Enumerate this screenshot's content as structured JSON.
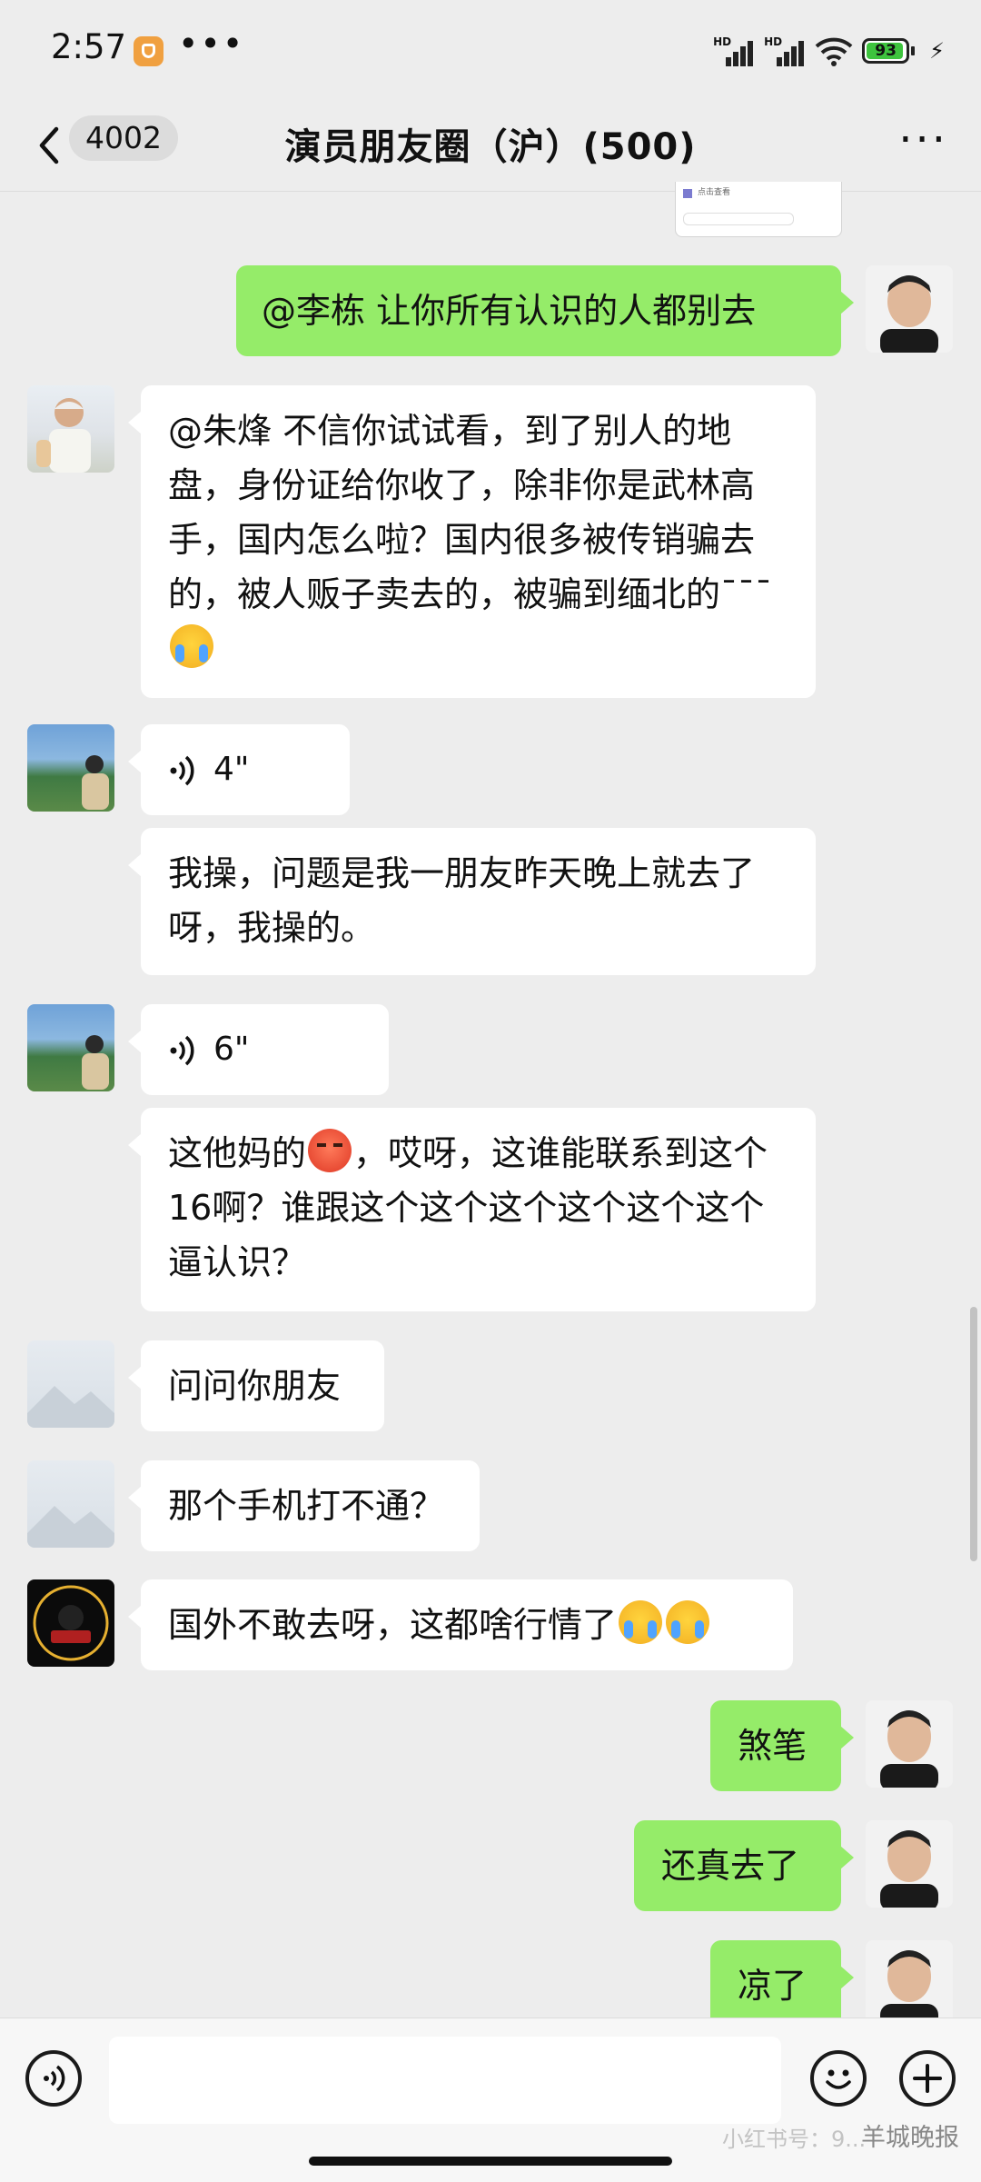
{
  "status_bar": {
    "time": "2:57",
    "battery": "93",
    "network_labels": [
      "HD",
      "HD"
    ]
  },
  "header": {
    "unread_count": "4002",
    "title": "演员朋友圈（沪）(500)"
  },
  "messages": [
    {
      "side": "right",
      "text": "@李栋  让你所有认识的人都别去"
    },
    {
      "side": "left",
      "text_parts": [
        "@朱烽 不信你试试看，到了别人的地盘，身份证给你收了，除非你是武林高手，国内怎么啦？国内很多被传销骗去的，被人贩子卖去的，被骗到缅北的¯¯¯"
      ],
      "emoji": "crying-emoji"
    },
    {
      "side": "left",
      "voice": "4\""
    },
    {
      "side": "left",
      "text": "我操，问题是我一朋友昨天晚上就去了呀，我操的。"
    },
    {
      "side": "left",
      "voice": "6\""
    },
    {
      "side": "left",
      "text_a": "这他妈的",
      "text_b": "，哎呀，这谁能联系到这个16啊？谁跟这个这个这个这个这个这个逼认识？",
      "emoji": "angry-emoji"
    },
    {
      "side": "left",
      "text": "问问你朋友"
    },
    {
      "side": "left",
      "text": "那个手机打不通？"
    },
    {
      "side": "left",
      "text": "国外不敢去呀，这都啥行情了",
      "emoji": "crying-emoji"
    },
    {
      "side": "right",
      "text": "煞笔"
    },
    {
      "side": "right",
      "text": "还真去了"
    },
    {
      "side": "right",
      "text": "凉了"
    }
  ],
  "thumbnail_caption": "点击查看",
  "watermark": "羊城晚报",
  "watermark_faint": "小红书号：9..."
}
